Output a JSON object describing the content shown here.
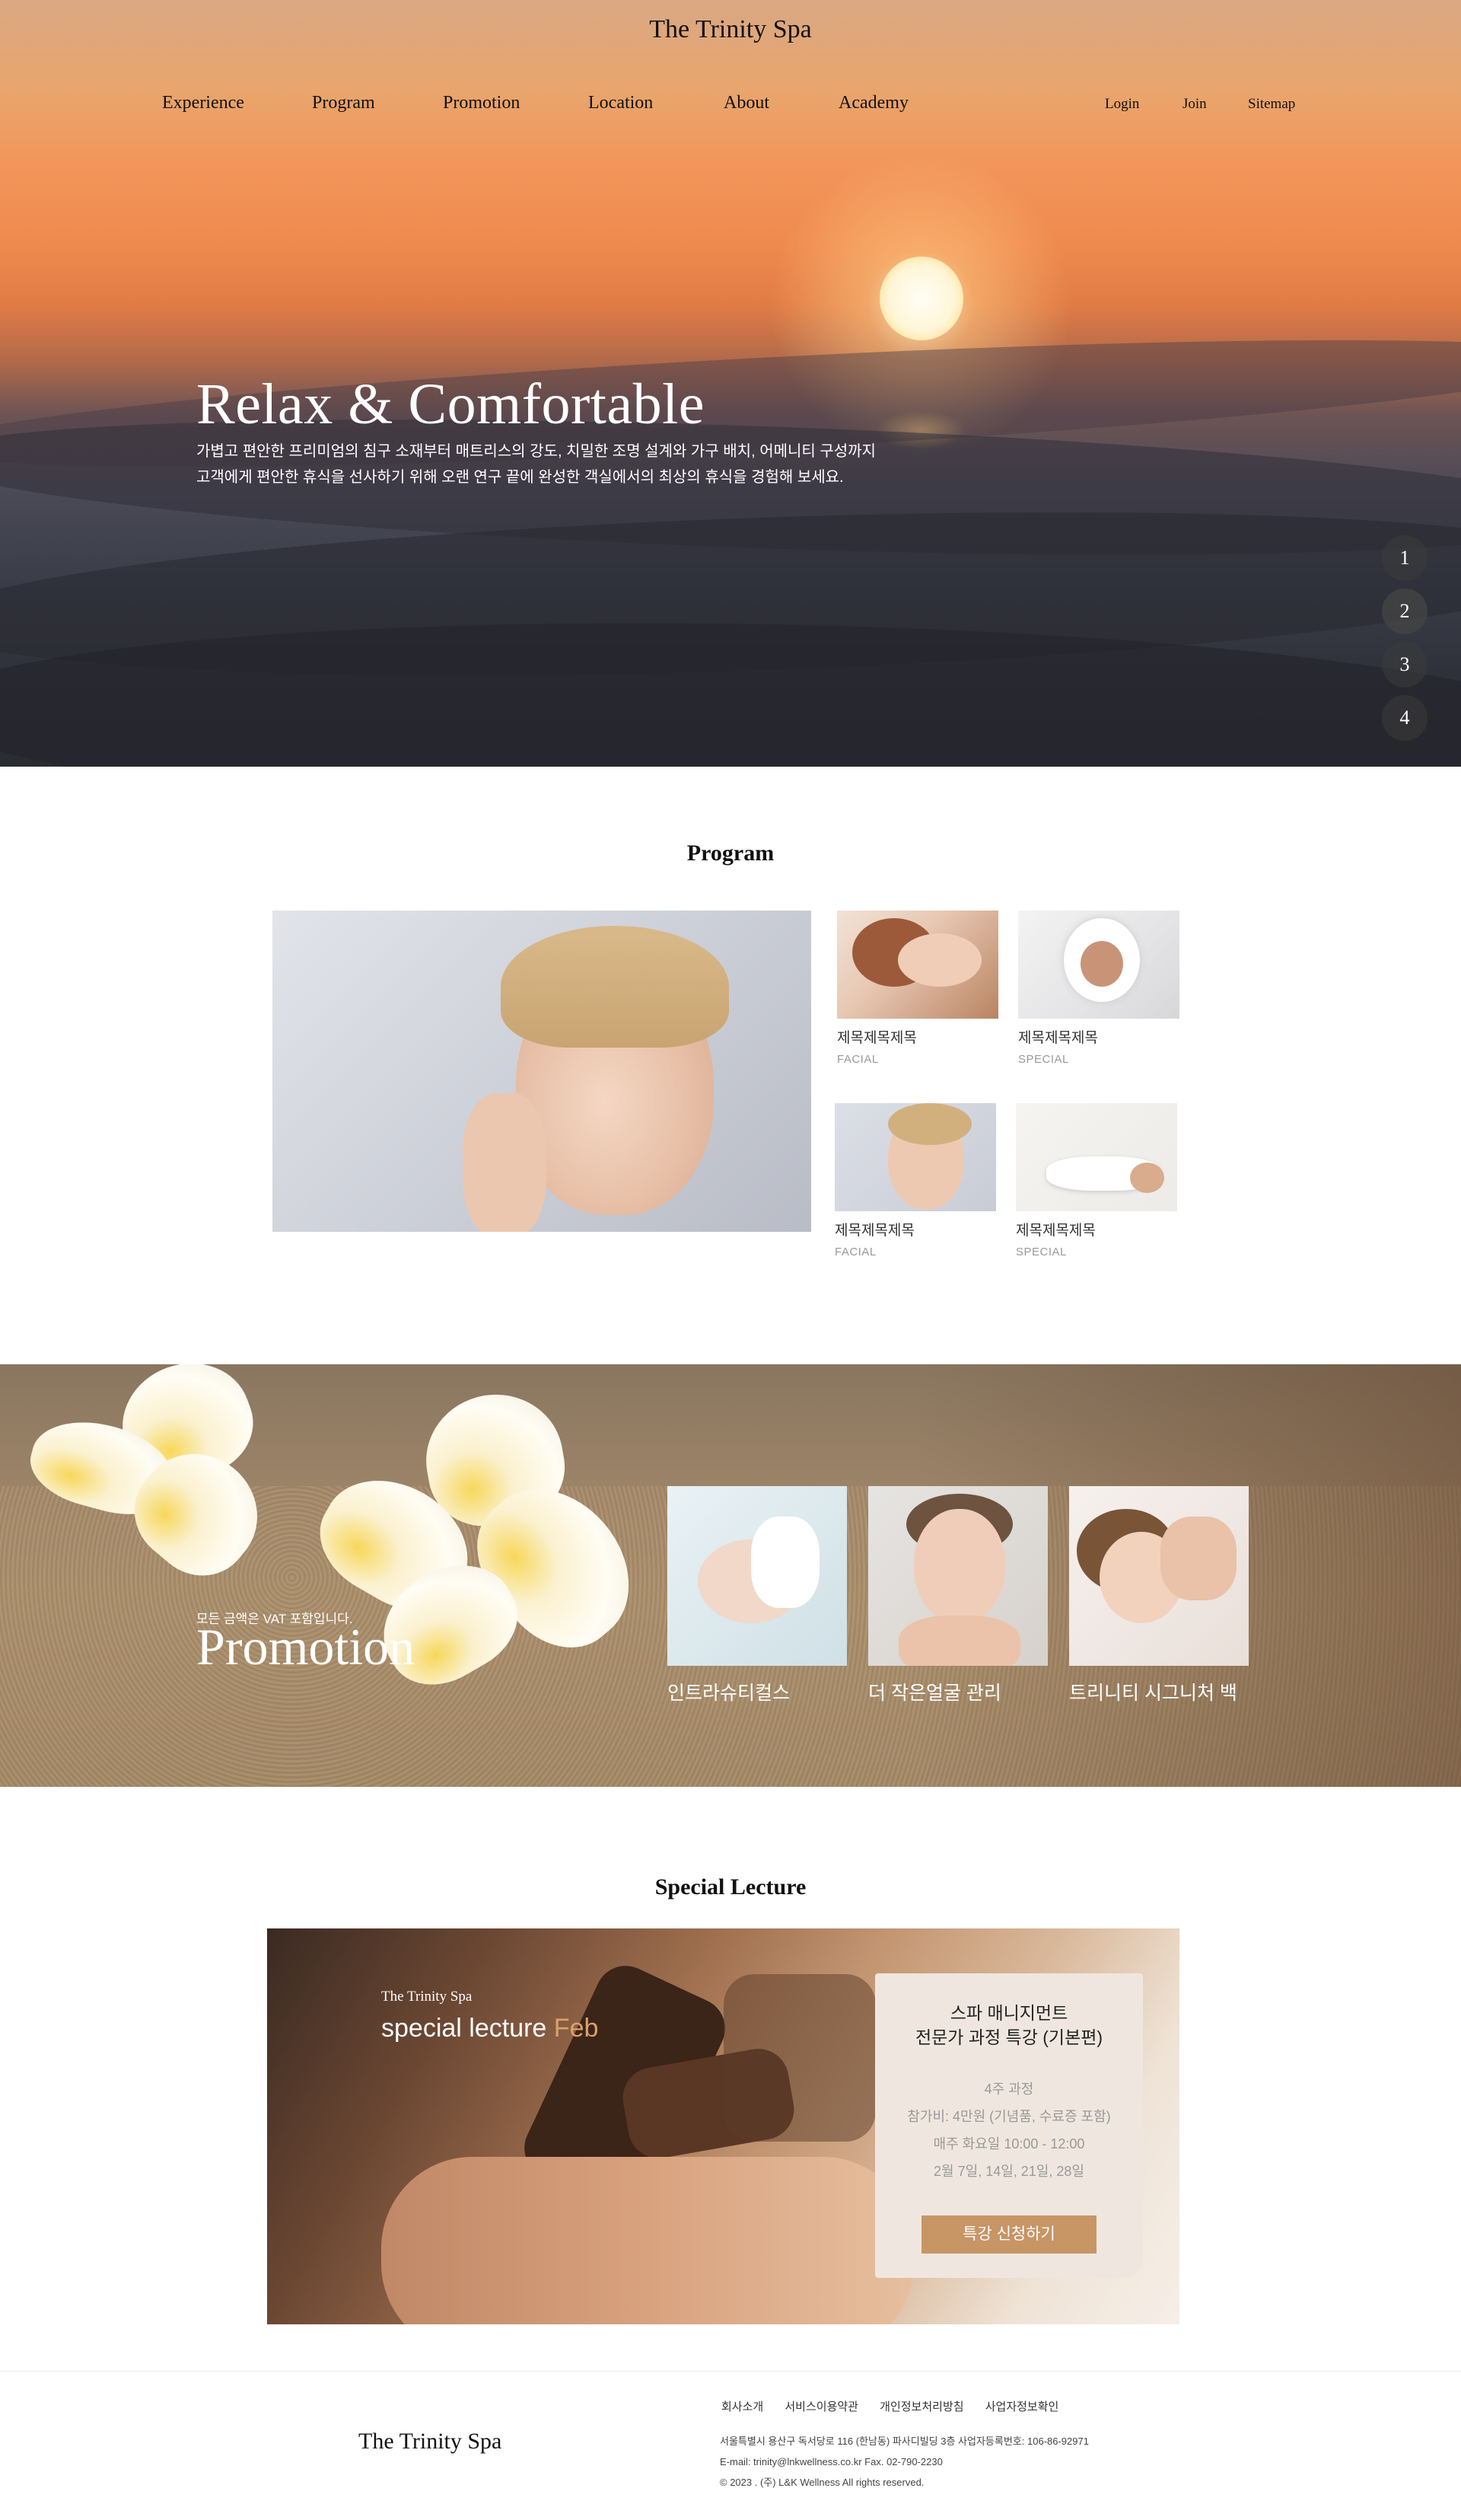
{
  "header": {
    "logo": "The Trinity Spa",
    "nav": [
      "Experience",
      "Program",
      "Promotion",
      "Location",
      "About",
      "Academy"
    ],
    "util": [
      "Login",
      "Join",
      "Sitemap"
    ]
  },
  "hero": {
    "title": "Relax & Comfortable",
    "desc_line1": "가볍고 편안한 프리미엄의 침구 소재부터 매트리스의 강도, 치밀한 조명 설계와 가구 배치, 어메니티 구성까지",
    "desc_line2": "고객에게 편안한 휴식을 선사하기 위해 오랜 연구 끝에 완성한 객실에서의 최상의 휴식을 경험해 보세요.",
    "slides": [
      "1",
      "2",
      "3",
      "4"
    ]
  },
  "program": {
    "title": "Program",
    "cards": [
      {
        "title": "제목제목제목",
        "sub": "FACIAL"
      },
      {
        "title": "제목제목제목",
        "sub": "SPECIAL"
      },
      {
        "title": "제목제목제목",
        "sub": "FACIAL"
      },
      {
        "title": "제목제목제목",
        "sub": "SPECIAL"
      }
    ]
  },
  "promotion": {
    "note": "모든 금액은 VAT 포함입니다.",
    "title": "Promotion",
    "cards": [
      {
        "caption": "인트라슈티컬스"
      },
      {
        "caption": "더 작은얼굴 관리"
      },
      {
        "caption": "트리니티 시그니처 백"
      }
    ]
  },
  "lecture": {
    "title": "Special Lecture",
    "brand": "The Trinity Spa",
    "subtitle": "special lecture",
    "subtitle_accent": "Feb",
    "box_title1": "스파 매니지먼트",
    "box_title2": "전문가 과정 특강 (기본편)",
    "info": [
      "4주 과정",
      "참가비: 4만원 (기념품, 수료증 포함)",
      "매주 화요일 10:00 - 12:00",
      "2월 7일, 14일, 21일, 28일"
    ],
    "button": "특강 신청하기"
  },
  "footer": {
    "logo": "The Trinity Spa",
    "links": [
      "회사소개",
      "서비스이용약관",
      "개인정보처리방침",
      "사업자정보확인"
    ],
    "address": "서울특별시 용산구 독서당로 116 (한남동) 파사디빌딩 3층    사업자등록번호: 106-86-92971",
    "contact": "E-mail: trinity@lnkwellness.co.kr     Fax. 02-790-2230",
    "copyright": "© 2023 . (주) L&K Wellness All rights reserved."
  },
  "colors": {
    "accent": "#c89565",
    "accent_text": "#d9a26a"
  }
}
